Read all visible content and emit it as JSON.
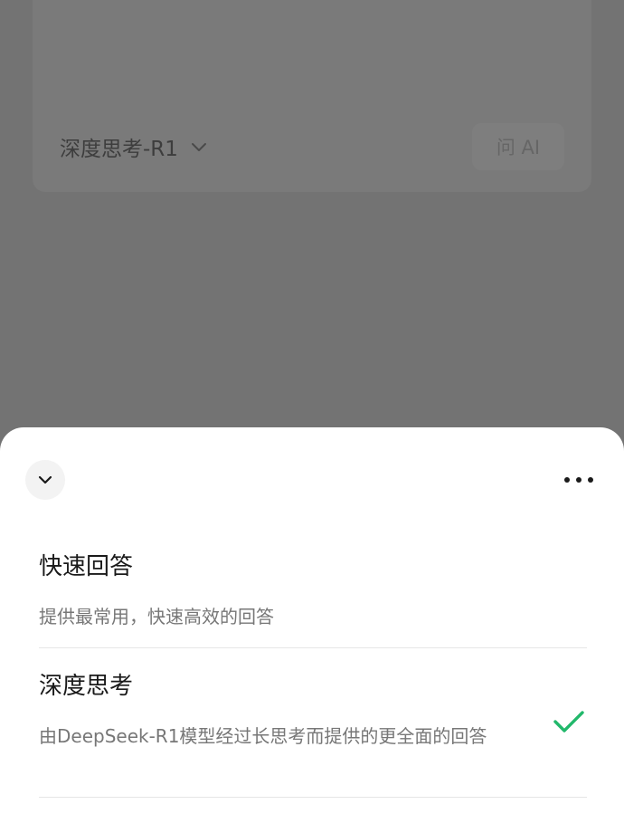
{
  "background": {
    "model_selector": "深度思考-R1",
    "ask_ai_label": "问 AI"
  },
  "sheet": {
    "options": [
      {
        "title": "快速回答",
        "description": "提供最常用，快速高效的回答",
        "selected": false
      },
      {
        "title": "深度思考",
        "description": "由DeepSeek-R1模型经过长思考而提供的更全面的回答",
        "selected": true
      }
    ],
    "icons": {
      "collapse": "chevron-down-icon",
      "more": "more-horizontal-icon",
      "selected": "checkmark-icon"
    }
  },
  "colors": {
    "overlay": "#737373",
    "sheet_background": "#ffffff",
    "check": "#22b86b"
  }
}
